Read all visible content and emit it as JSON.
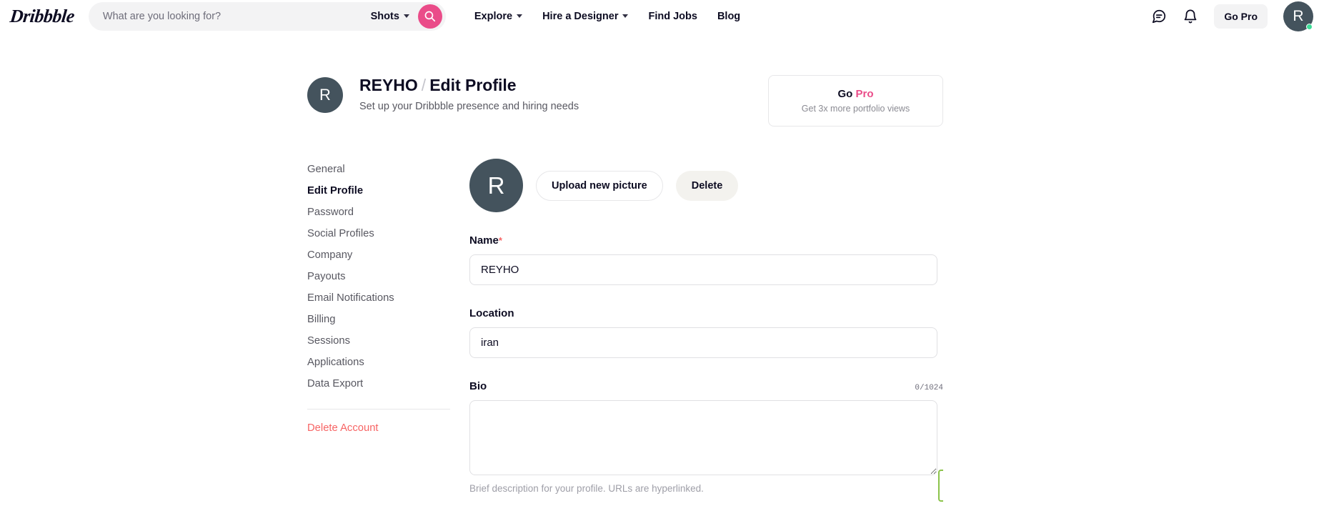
{
  "header": {
    "logo_text": "Dribbble",
    "search": {
      "placeholder": "What are you looking for?",
      "value": "",
      "scope_label": "Shots"
    },
    "nav": [
      {
        "label": "Explore",
        "has_chevron": true
      },
      {
        "label": "Hire a Designer",
        "has_chevron": true
      },
      {
        "label": "Find Jobs",
        "has_chevron": false
      },
      {
        "label": "Blog",
        "has_chevron": false
      }
    ],
    "messages_icon": "message-icon",
    "notifications_icon": "bell-icon",
    "go_pro_label": "Go Pro",
    "avatar_initial": "R"
  },
  "profile": {
    "avatar_initial": "R",
    "breadcrumb_user": "REYHO",
    "breadcrumb_separator": "/",
    "breadcrumb_page": "Edit Profile",
    "subtitle": "Set up your Dribbble presence and hiring needs"
  },
  "go_pro_card": {
    "title_prefix": "Go ",
    "title_highlight": "Pro",
    "subtitle": "Get 3x more portfolio views"
  },
  "sidebar": {
    "items": [
      {
        "label": "General",
        "active": false
      },
      {
        "label": "Edit Profile",
        "active": true
      },
      {
        "label": "Password",
        "active": false
      },
      {
        "label": "Social Profiles",
        "active": false
      },
      {
        "label": "Company",
        "active": false
      },
      {
        "label": "Payouts",
        "active": false
      },
      {
        "label": "Email Notifications",
        "active": false
      },
      {
        "label": "Billing",
        "active": false
      },
      {
        "label": "Sessions",
        "active": false
      },
      {
        "label": "Applications",
        "active": false
      },
      {
        "label": "Data Export",
        "active": false
      }
    ],
    "delete_account_label": "Delete Account"
  },
  "form": {
    "avatar_initial": "R",
    "upload_label": "Upload new picture",
    "delete_label": "Delete",
    "name": {
      "label": "Name",
      "required_marker": "*",
      "value": "REYHO",
      "placeholder": ""
    },
    "location": {
      "label": "Location",
      "value": "iran",
      "placeholder": ""
    },
    "bio": {
      "label": "Bio",
      "counter": "0/1024",
      "value": "",
      "placeholder": "",
      "helper": "Brief description for your profile. URLs are hyperlinked."
    }
  },
  "colors": {
    "brand_pink": "#ea4c89",
    "dark": "#0d0c22",
    "danger": "#f76464",
    "avatar_bg": "#44535d",
    "online": "#3ddc97",
    "edge_green": "#8bc34a"
  }
}
